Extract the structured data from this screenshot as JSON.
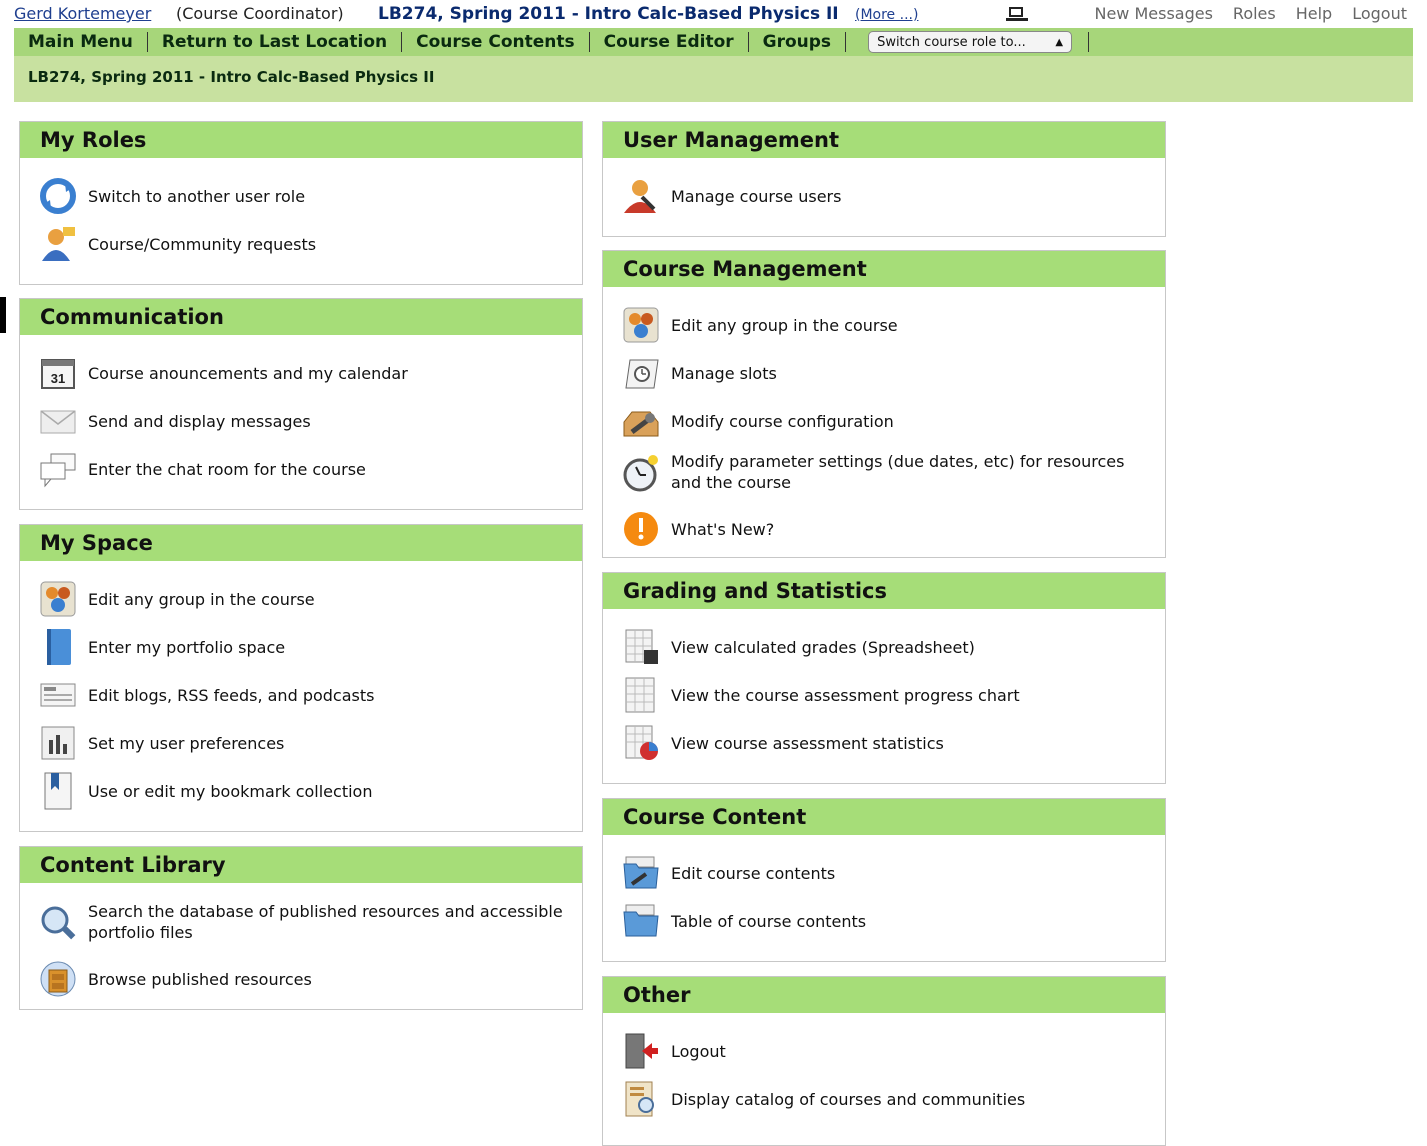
{
  "topbar": {
    "user_name": "Gerd Kortemeyer",
    "user_role": "(Course Coordinator)",
    "course_title": "LB274, Spring 2011 - Intro Calc-Based Physics II",
    "more_link": "(More ...)",
    "links": [
      "New Messages",
      "Roles",
      "Help",
      "Logout"
    ]
  },
  "menubar": {
    "items": [
      "Main Menu",
      "Return to Last Location",
      "Course Contents",
      "Course Editor",
      "Groups"
    ],
    "role_select": "Switch course role to..."
  },
  "breadcrumb": "LB274, Spring 2011 - Intro Calc-Based Physics II",
  "panels": {
    "my_roles": {
      "title": "My Roles",
      "items": [
        "Switch to another user role",
        "Course/Community requests"
      ]
    },
    "communication": {
      "title": "Communication",
      "items": [
        "Course anouncements and my calendar",
        "Send and display messages",
        "Enter the chat room for the course"
      ]
    },
    "my_space": {
      "title": "My Space",
      "items": [
        "Edit any group in the course",
        "Enter my portfolio space",
        "Edit blogs, RSS feeds, and podcasts",
        "Set my user preferences",
        "Use or edit my bookmark collection"
      ]
    },
    "content_library": {
      "title": "Content Library",
      "items": [
        "Search the database of published resources and accessible portfolio files",
        "Browse published resources"
      ]
    },
    "user_management": {
      "title": "User Management",
      "items": [
        "Manage course users"
      ]
    },
    "course_management": {
      "title": "Course Management",
      "items": [
        "Edit any group in the course",
        "Manage slots",
        "Modify course configuration",
        "Modify parameter settings (due dates, etc) for resources and the course",
        "What's New?"
      ]
    },
    "grading": {
      "title": "Grading and Statistics",
      "items": [
        "View calculated grades (Spreadsheet)",
        "View the course assessment progress chart",
        "View course assessment statistics"
      ]
    },
    "course_content": {
      "title": "Course Content",
      "items": [
        "Edit course contents",
        "Table of course contents"
      ]
    },
    "other": {
      "title": "Other",
      "items": [
        "Logout",
        "Display catalog of courses and communities"
      ]
    }
  },
  "colors": {
    "menubar": "#a7d67a",
    "breadcrumb": "#c8e1a0",
    "panel_header": "#a6dd78",
    "link_blue": "#1f3f8f"
  }
}
